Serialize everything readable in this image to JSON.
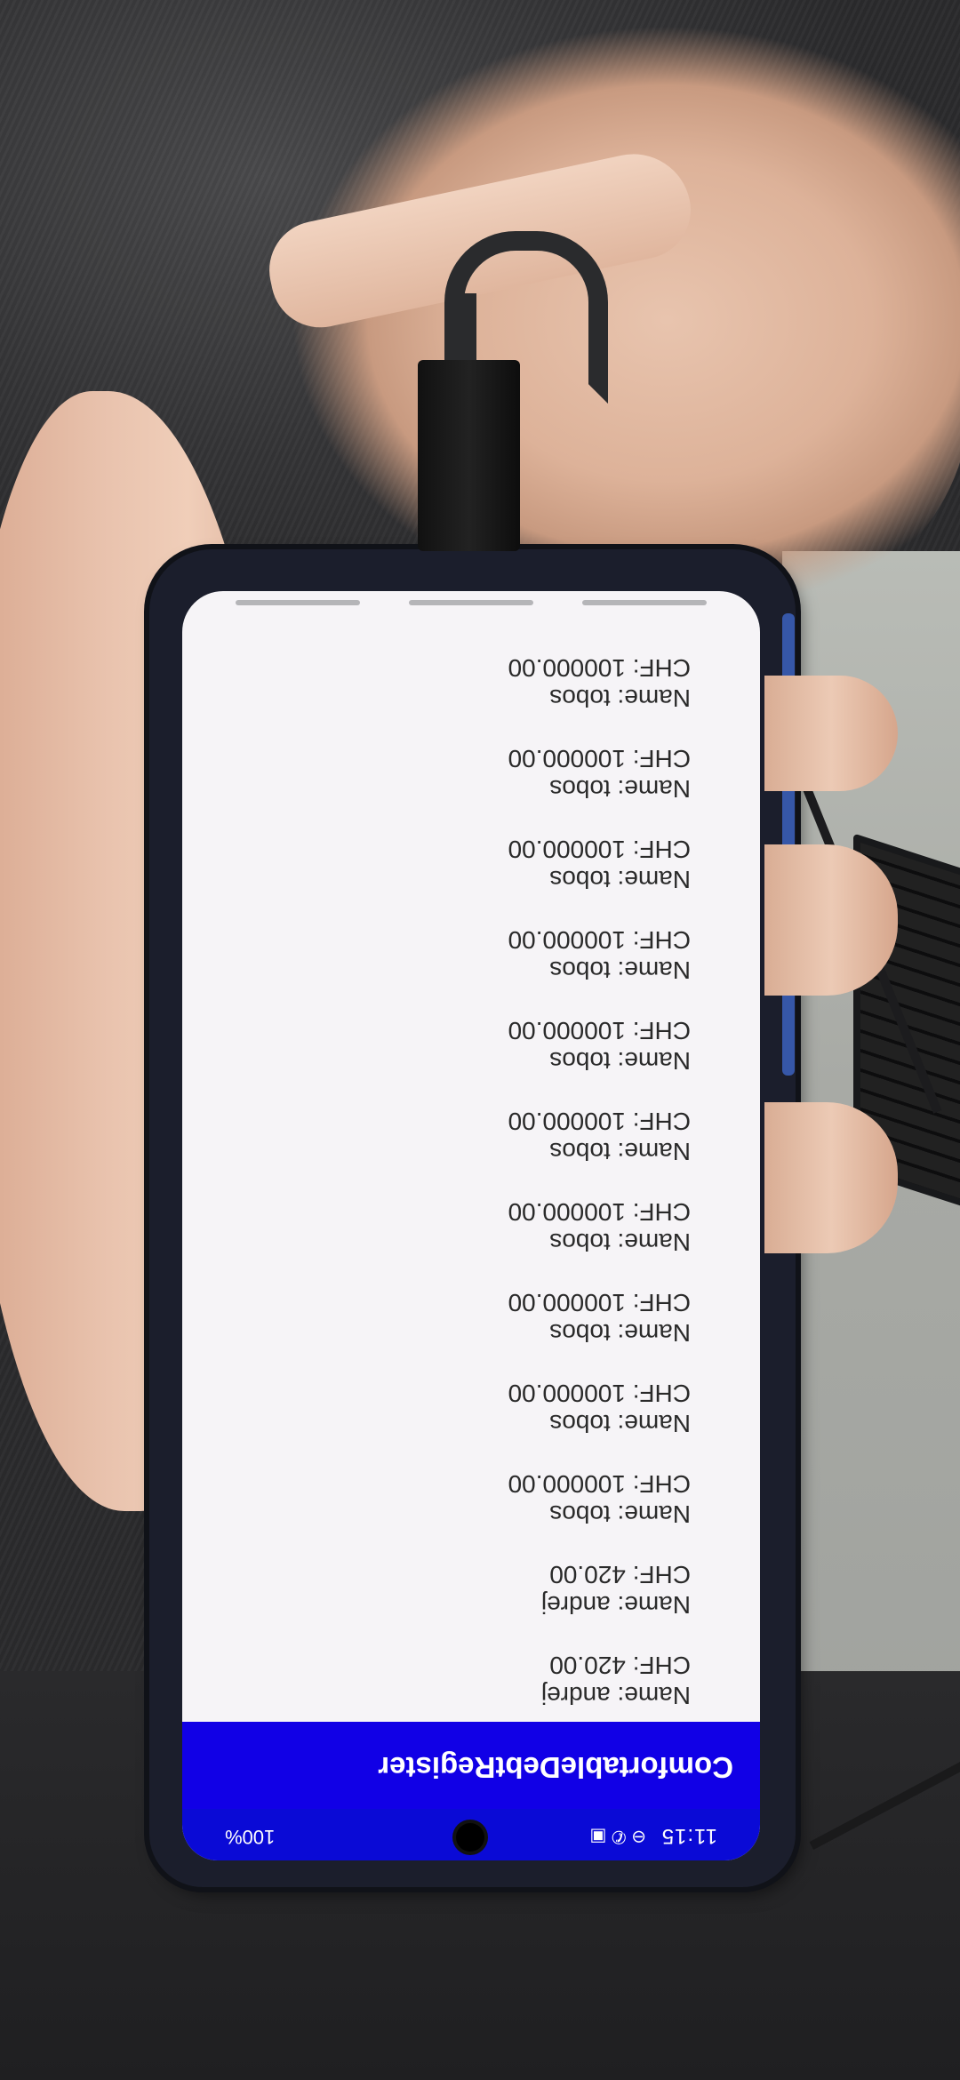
{
  "status_bar": {
    "time": "11:15",
    "left_icons": "⊖ ✆ ▣",
    "battery": "100%"
  },
  "app": {
    "title": "ComfortableDebtRegister"
  },
  "debts": [
    {
      "name": "Name: andrej",
      "amount": "CHF: 420.00"
    },
    {
      "name": "Name: andrej",
      "amount": "CHF: 420.00"
    },
    {
      "name": "Name: tobos",
      "amount": "CHF: 100000.00"
    },
    {
      "name": "Name: tobos",
      "amount": "CHF: 100000.00"
    },
    {
      "name": "Name: tobos",
      "amount": "CHF: 100000.00"
    },
    {
      "name": "Name: tobos",
      "amount": "CHF: 100000.00"
    },
    {
      "name": "Name: tobos",
      "amount": "CHF: 100000.00"
    },
    {
      "name": "Name: tobos",
      "amount": "CHF: 100000.00"
    },
    {
      "name": "Name: tobos",
      "amount": "CHF: 100000.00"
    },
    {
      "name": "Name: tobos",
      "amount": "CHF: 100000.00"
    },
    {
      "name": "Name: tobos",
      "amount": "CHF: 100000.00"
    },
    {
      "name": "Name: tobos",
      "amount": "CHF: 100000.00"
    }
  ],
  "colors": {
    "app_bar": "#1100e6",
    "status_bar": "#0a0ad6",
    "background": "#f6f4f7"
  }
}
